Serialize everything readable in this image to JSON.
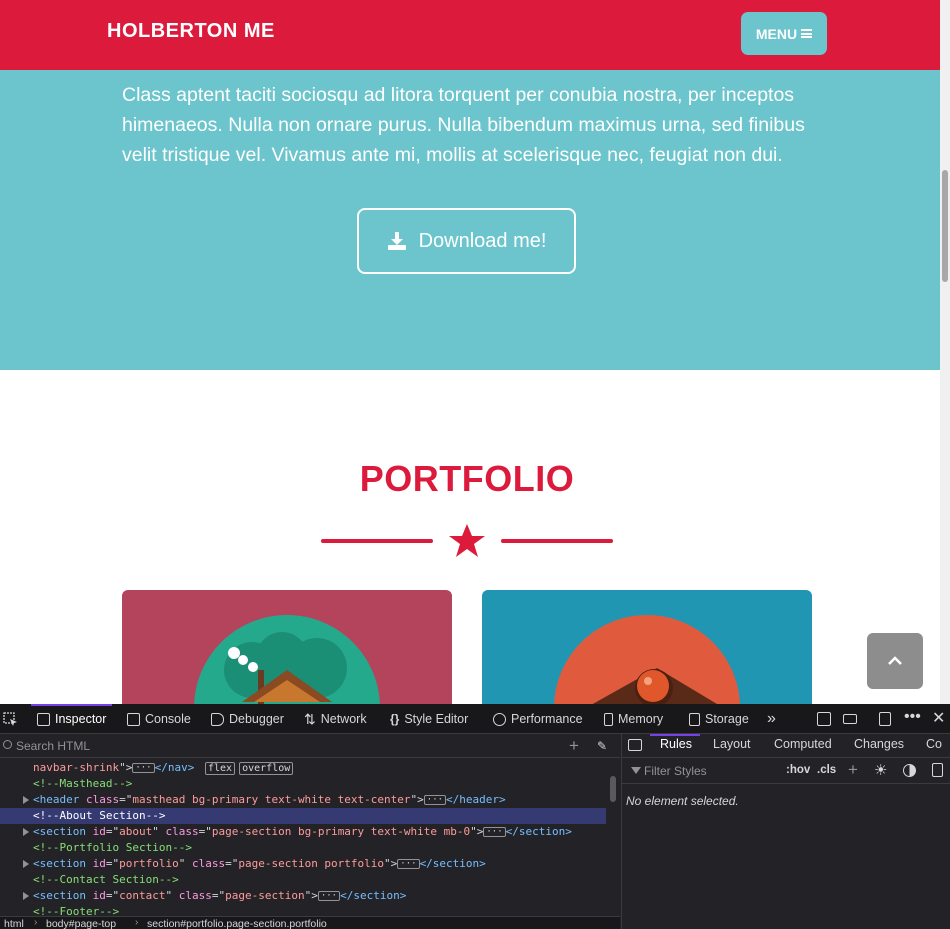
{
  "navbar": {
    "brand": "HOLBERTON ME",
    "menu_label": "MENU"
  },
  "about": {
    "text": "Class aptent taciti sociosqu ad litora torquent per conubia nostra, per inceptos himenaeos. Nulla non ornare purus. Nulla bibendum maximus urna, sed finibus velit tristique vel. Vivamus ante mi, mollis at scelerisque nec, feugiat non dui.",
    "download_label": "Download me!"
  },
  "portfolio": {
    "title": "PORTFOLIO"
  },
  "colors": {
    "primary": "#dc1a3c",
    "secondary": "#6cc5cc",
    "tile1": "#b4445b",
    "tile2": "#2196b2"
  },
  "devtools": {
    "tabs": [
      {
        "label": "Inspector",
        "icon": "inspector-icon"
      },
      {
        "label": "Console",
        "icon": "console-icon"
      },
      {
        "label": "Debugger",
        "icon": "debugger-icon"
      },
      {
        "label": "Network",
        "icon": "network-icon"
      },
      {
        "label": "Style Editor",
        "icon": "style-editor-icon"
      },
      {
        "label": "Performance",
        "icon": "performance-icon"
      },
      {
        "label": "Memory",
        "icon": "memory-icon"
      },
      {
        "label": "Storage",
        "icon": "storage-icon"
      }
    ],
    "search_placeholder": "Search HTML",
    "tree": {
      "n0_pre": "navbar-shrink",
      "n0_post": "</nav>",
      "badge_flex": "flex",
      "badge_overflow": "overflow",
      "c_masthead": "<!--Masthead-->",
      "header_tag": "header",
      "header_class": "masthead bg-primary text-white text-center",
      "c_about": "<!--About Section-->",
      "about_id": "about",
      "about_class": "page-section bg-primary text-white mb-0",
      "c_portfolio": "<!--Portfolio Section-->",
      "portfolio_id": "portfolio",
      "portfolio_class": "page-section portfolio",
      "c_contact": "<!--Contact Section-->",
      "contact_id": "contact",
      "contact_class": "page-section",
      "c_footer": "<!--Footer-->"
    },
    "breadcrumbs": [
      "html",
      "body#page-top",
      "section#portfolio.page-section.portfolio"
    ],
    "rules_tabs": [
      "Rules",
      "Layout",
      "Computed",
      "Changes",
      "Co"
    ],
    "filter_placeholder": "Filter Styles",
    "hov": ":hov",
    "cls": ".cls",
    "no_element": "No element selected."
  }
}
